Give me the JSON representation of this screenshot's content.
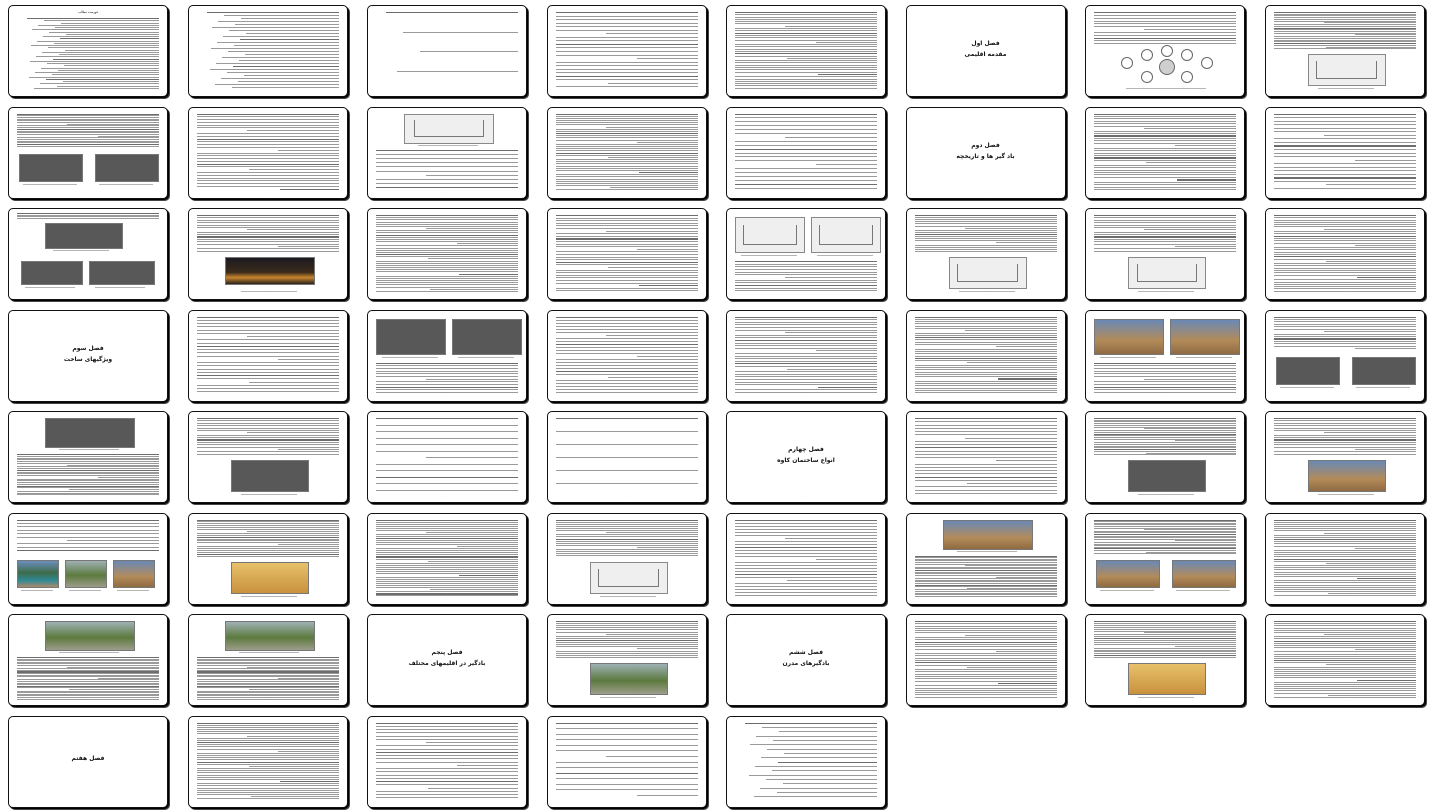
{
  "document": {
    "columns": 8,
    "rows": 8,
    "page_count": 57
  },
  "pages": [
    {
      "kind": "toc",
      "lines": 32,
      "header": "فهرست مطالب"
    },
    {
      "kind": "toc",
      "lines": 26
    },
    {
      "kind": "toc",
      "lines": 4
    },
    {
      "kind": "text",
      "lines": 22
    },
    {
      "kind": "text",
      "lines": 34
    },
    {
      "kind": "chapter",
      "title": "فصل اول",
      "subtitle": "مقدمه اقلیمی"
    },
    {
      "kind": "text-diagram",
      "lines": 12
    },
    {
      "kind": "text-figure",
      "lines": 22,
      "figure": "sketch"
    },
    {
      "kind": "text-figures",
      "lines": 20,
      "figures": [
        "dark",
        "dark"
      ]
    },
    {
      "kind": "text",
      "lines": 28
    },
    {
      "kind": "figure-text",
      "lines": 10,
      "figure": "sketch"
    },
    {
      "kind": "text",
      "lines": 36
    },
    {
      "kind": "text",
      "lines": 20
    },
    {
      "kind": "chapter",
      "title": "فصل دوم",
      "subtitle": "باد گیر ها و تاریخچه"
    },
    {
      "kind": "text",
      "lines": 32
    },
    {
      "kind": "text",
      "lines": 22
    },
    {
      "kind": "figures",
      "lines": 14,
      "figures": [
        "dark",
        "dark",
        "dark"
      ]
    },
    {
      "kind": "text-figure",
      "lines": 16,
      "figure": "night"
    },
    {
      "kind": "text",
      "lines": 36
    },
    {
      "kind": "text",
      "lines": 30
    },
    {
      "kind": "figures-text",
      "lines": 12,
      "figures": [
        "sketch",
        "sketch"
      ]
    },
    {
      "kind": "text-figure",
      "lines": 18,
      "figure": "sketch"
    },
    {
      "kind": "text-figure",
      "lines": 16,
      "figure": "sketch"
    },
    {
      "kind": "text",
      "lines": 34
    },
    {
      "kind": "chapter",
      "title": "فصل سوم",
      "subtitle": "ویژگیهای ساخت"
    },
    {
      "kind": "text",
      "lines": 24
    },
    {
      "kind": "figures-text",
      "lines": 12,
      "figures": [
        "dark",
        "dark"
      ]
    },
    {
      "kind": "text",
      "lines": 26
    },
    {
      "kind": "text",
      "lines": 30
    },
    {
      "kind": "text",
      "lines": 34
    },
    {
      "kind": "figures-text",
      "lines": 12,
      "figures": [
        "color",
        "color"
      ]
    },
    {
      "kind": "text-figures",
      "lines": 14,
      "figures": [
        "dark",
        "dark"
      ]
    },
    {
      "kind": "figure-text",
      "lines": 24,
      "figure": "dark"
    },
    {
      "kind": "text-figure",
      "lines": 16,
      "figure": "dark"
    },
    {
      "kind": "text",
      "lines": 12
    },
    {
      "kind": "text",
      "lines": 6
    },
    {
      "kind": "chapter",
      "title": "فصل چهارم",
      "subtitle": "انواع ساختمان کاوه"
    },
    {
      "kind": "text",
      "lines": 24
    },
    {
      "kind": "text-figure",
      "lines": 22,
      "figure": "dark"
    },
    {
      "kind": "text-figure",
      "lines": 16,
      "figure": "color"
    },
    {
      "kind": "text-figures",
      "lines": 10,
      "figures": [
        "pool",
        "green",
        "color"
      ]
    },
    {
      "kind": "text-figure",
      "lines": 20,
      "figure": "sand"
    },
    {
      "kind": "text",
      "lines": 38
    },
    {
      "kind": "text-figure",
      "lines": 18,
      "figure": "sketch"
    },
    {
      "kind": "text",
      "lines": 26
    },
    {
      "kind": "figure-text",
      "lines": 26,
      "figure": "color"
    },
    {
      "kind": "text-figures",
      "lines": 22,
      "figures": [
        "color",
        "color"
      ]
    },
    {
      "kind": "text",
      "lines": 36
    },
    {
      "kind": "figure-text",
      "lines": 28,
      "figure": "green"
    },
    {
      "kind": "figure-text",
      "lines": 28,
      "figure": "green"
    },
    {
      "kind": "chapter",
      "title": "فصل پنجم",
      "subtitle": "بادگیر در اقلیمهای مختلف"
    },
    {
      "kind": "text-figure",
      "lines": 18,
      "figure": "green"
    },
    {
      "kind": "chapter",
      "title": "فصل ششم",
      "subtitle": "بادگیرهای مدرن"
    },
    {
      "kind": "text",
      "lines": 34
    },
    {
      "kind": "text-figure",
      "lines": 20,
      "figure": "sand"
    },
    {
      "kind": "text",
      "lines": 36
    },
    {
      "kind": "chapter",
      "title": "فصل هفتم",
      "subtitle": ""
    },
    {
      "kind": "text",
      "lines": 36
    },
    {
      "kind": "text",
      "lines": 24
    },
    {
      "kind": "text",
      "lines": 14
    },
    {
      "kind": "toc",
      "lines": 18
    }
  ]
}
